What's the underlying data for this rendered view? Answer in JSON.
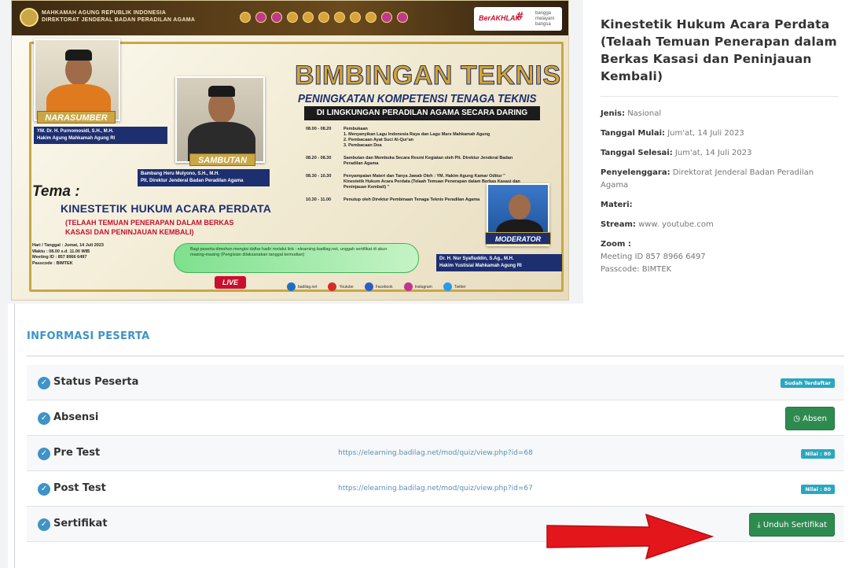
{
  "banner": {
    "org_name": "MAHKAMAH AGUNG REPUBLIK INDONESIA\nDIREKTORAT JENDERAL BADAN PERADILAN AGAMA",
    "brand_left": "BerAKHLAK",
    "brand_right": "#",
    "brand_tag": "bangga\nmelayani\nbangsa",
    "title_main": "BIMBINGAN TEKNIS",
    "title_sub": "PENINGKATAN KOMPETENSI TENAGA TEKNIS",
    "title_sub2": "DI LINGKUNGAN PERADILAN AGAMA SECARA DARING",
    "schedule": [
      {
        "time": "08.00 - 08.20",
        "desc": "Pembukaan\n1. Menyanyikan Lagu Indonesia Raya dan Lagu Mars Mahkamah Agung\n2. Pembacaan Ayat Suci Al-Qur'an\n3. Pembacaan Doa"
      },
      {
        "time": "08.20 - 08.30",
        "desc": "Sambutan dan Membuka Secara Resmi Kegiatan oleh Plt. Direktur Jenderal Badan Peradilan Agama"
      },
      {
        "time": "08.30 - 10.30",
        "desc": "Penyampaian Materi dan Tanya Jawab Oleh : YM. Hakim Agung Kamar Oditur \" Kinestetik Hukum Acara Perdata (Telaah Temuan Penerapan dalam Berkas Kasasi dan Peninjauan Kembali) \""
      },
      {
        "time": "10.30 - 11.00",
        "desc": "Penutup oleh Direktur Pembinaan Tenaga Teknis Peradilan Agama"
      }
    ],
    "ribbon_narasumber": "NARASUMBER",
    "narasumber_name": "YM. Dr. H. Purnomosidi, S.H., M.H.\nHakim Agung Mahkamah Agung RI",
    "ribbon_sambutan": "SAMBUTAN",
    "sambutan_name": "Bambang Heru Mulyono, S.H., M.H.\nPlt. Direktur Jenderal Badan Peradilan Agama",
    "ribbon_moderator": "MODERATOR",
    "moderator_name": "Dr. H. Nur Syafiuddin, S.Ag., M.H.\nHakim Yustisial Mahkamah Agung RI",
    "tema_label": "Tema :",
    "tema_title": "KINESTETIK HUKUM ACARA PERDATA",
    "tema_sub": "(TELAAH TEMUAN PENERAPAN DALAM BERKAS\nKASASI DAN PENINJAUAN KEMBALI)",
    "details": "Hari / Tanggal : Jumat, 14 Juli 2023\nWaktu : 08.00 s.d. 11.00 WIB\nMeeting ID : 857 8966 6497\nPasscode : BIMTEK",
    "green_note": "Bagi peserta dimohon mengisi daftar hadir melalui link : elearning.badilag.net, unggah sertifikat di akun masing-masing (Pengisian dilaksanakan tanggal kemudian)",
    "live_label": "LIVE",
    "socials": [
      "badilag.net",
      "Youtube",
      "Facebook",
      "Instagram",
      "Twitter"
    ]
  },
  "info": {
    "title": "Kinestetik Hukum Acara Perdata (Telaah Temuan Penerapan dalam Berkas Kasasi dan Peninjauan Kembali)",
    "jenis_label": "Jenis:",
    "jenis_value": "Nasional",
    "mulai_label": "Tanggal Mulai:",
    "mulai_value": "Jum'at, 14 Juli 2023",
    "selesai_label": "Tanggal Selesai:",
    "selesai_value": "Jum'at, 14 Juli 2023",
    "penyelenggara_label": "Penyelenggara:",
    "penyelenggara_value": "Direktorat Jenderal Badan Peradilan Agama",
    "materi_label": "Materi:",
    "stream_label": "Stream:",
    "stream_value": "www. youtube.com",
    "zoom_label": "Zoom :",
    "zoom_meeting": "Meeting ID 857 8966 6497",
    "zoom_passcode": "Passcode: BIMTEK"
  },
  "participant": {
    "section_title": "INFORMASI PESERTA",
    "status_label": "Status Peserta",
    "status_badge": "Sudah Terdaftar",
    "absensi_label": "Absensi",
    "absen_button": "Absen",
    "pretest_label": "Pre Test",
    "pretest_link": "https://elearning.badilag.net/mod/quiz/view.php?id=68",
    "pretest_badge": "Nilai : 80",
    "posttest_label": "Post Test",
    "posttest_link": "https://elearning.badilag.net/mod/quiz/view.php?id=67",
    "posttest_badge": "Nilai : 80",
    "sertifikat_label": "Sertifikat",
    "unduh_button": "Unduh Sertifikat"
  },
  "colors": {
    "accent_blue": "#3f93c6",
    "success_green": "#2e8b4f",
    "badge_teal": "#2aa7c0",
    "arrow_red": "#e3161b"
  }
}
